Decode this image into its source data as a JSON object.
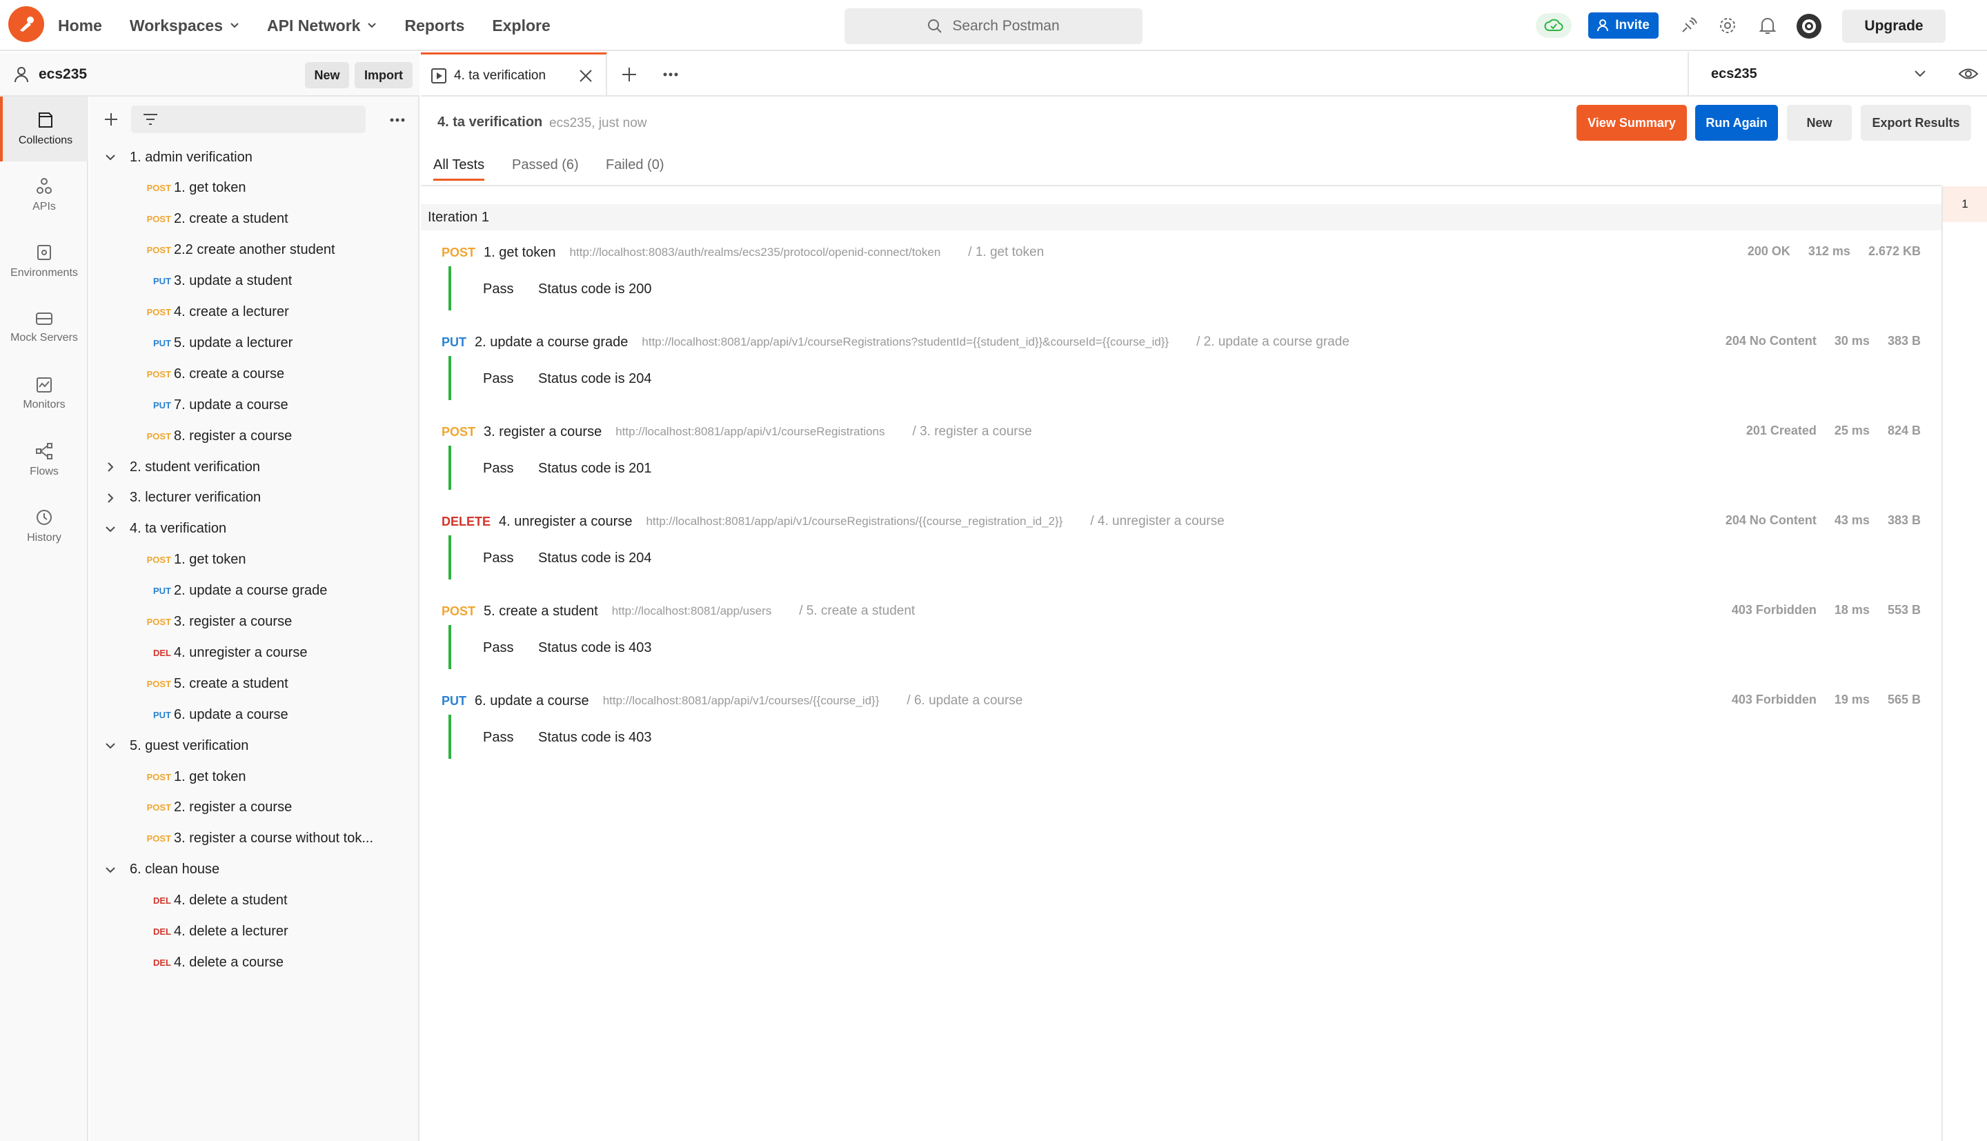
{
  "app": {
    "brand_color": "#ef5b25",
    "nav": [
      "Home",
      "Workspaces",
      "API Network",
      "Reports",
      "Explore"
    ],
    "search_placeholder": "Search Postman",
    "invite_label": "Invite",
    "upgrade_label": "Upgrade"
  },
  "workspace": {
    "name": "ecs235",
    "new_label": "New",
    "import_label": "Import"
  },
  "rail": [
    "Collections",
    "APIs",
    "Environments",
    "Mock Servers",
    "Monitors",
    "Flows",
    "History"
  ],
  "tree": [
    {
      "type": "folder",
      "label": "1. admin verification",
      "open": true
    },
    {
      "type": "req",
      "method": "POST",
      "label": "1. get token"
    },
    {
      "type": "req",
      "method": "POST",
      "label": "2. create a student"
    },
    {
      "type": "req",
      "method": "POST",
      "label": "2.2 create another student"
    },
    {
      "type": "req",
      "method": "PUT",
      "label": "3. update a student"
    },
    {
      "type": "req",
      "method": "POST",
      "label": "4. create a lecturer"
    },
    {
      "type": "req",
      "method": "PUT",
      "label": "5. update a lecturer"
    },
    {
      "type": "req",
      "method": "POST",
      "label": "6. create a course"
    },
    {
      "type": "req",
      "method": "PUT",
      "label": "7. update a course"
    },
    {
      "type": "req",
      "method": "POST",
      "label": "8. register a course"
    },
    {
      "type": "folder",
      "label": "2. student verification",
      "open": false
    },
    {
      "type": "folder",
      "label": "3. lecturer verification",
      "open": false
    },
    {
      "type": "folder",
      "label": "4. ta verification",
      "open": true
    },
    {
      "type": "req",
      "method": "POST",
      "label": "1. get token"
    },
    {
      "type": "req",
      "method": "PUT",
      "label": "2. update a course grade"
    },
    {
      "type": "req",
      "method": "POST",
      "label": "3. register a course"
    },
    {
      "type": "req",
      "method": "DEL",
      "label": "4. unregister a course"
    },
    {
      "type": "req",
      "method": "POST",
      "label": "5. create a student"
    },
    {
      "type": "req",
      "method": "PUT",
      "label": "6. update a course"
    },
    {
      "type": "folder",
      "label": "5. guest verification",
      "open": true
    },
    {
      "type": "req",
      "method": "POST",
      "label": "1. get token"
    },
    {
      "type": "req",
      "method": "POST",
      "label": "2. register a course"
    },
    {
      "type": "req",
      "method": "POST",
      "label": "3. register a course without tok..."
    },
    {
      "type": "folder",
      "label": "6. clean house",
      "open": true
    },
    {
      "type": "req",
      "method": "DEL",
      "label": "4. delete a student"
    },
    {
      "type": "req",
      "method": "DEL",
      "label": "4. delete a lecturer"
    },
    {
      "type": "req",
      "method": "DEL",
      "label": "4. delete a course"
    }
  ],
  "tab": {
    "title": "4. ta verification",
    "environment": "ecs235"
  },
  "runner": {
    "title": "4. ta verification",
    "subtitle": "ecs235, just now",
    "buttons": {
      "view_summary": "View Summary",
      "run_again": "Run Again",
      "new": "New",
      "export": "Export Results"
    },
    "filters": [
      "All Tests",
      "Passed (6)",
      "Failed (0)"
    ],
    "iteration_label": "Iteration 1",
    "iteration_number": "1",
    "requests": [
      {
        "method": "POST",
        "name": "1. get token",
        "url": "http://localhost:8083/auth/realms/ecs235/protocol/openid-connect/token",
        "path": "/ 1. get token",
        "status": "200 OK",
        "time": "312 ms",
        "size": "2.672 KB",
        "test_result": "Pass",
        "test_name": "Status code is 200"
      },
      {
        "method": "PUT",
        "name": "2. update a course grade",
        "url": "http://localhost:8081/app/api/v1/courseRegistrations?studentId={{student_id}}&courseId={{course_id}}",
        "path": "/ 2. update a course grade",
        "status": "204 No Content",
        "time": "30 ms",
        "size": "383 B",
        "test_result": "Pass",
        "test_name": "Status code is 204"
      },
      {
        "method": "POST",
        "name": "3. register a course",
        "url": "http://localhost:8081/app/api/v1/courseRegistrations",
        "path": "/ 3. register a course",
        "status": "201 Created",
        "time": "25 ms",
        "size": "824 B",
        "test_result": "Pass",
        "test_name": "Status code is 201"
      },
      {
        "method": "DELETE",
        "name": "4. unregister a course",
        "url": "http://localhost:8081/app/api/v1/courseRegistrations/{{course_registration_id_2}}",
        "path": "/ 4. unregister a course",
        "status": "204 No Content",
        "time": "43 ms",
        "size": "383 B",
        "test_result": "Pass",
        "test_name": "Status code is 204"
      },
      {
        "method": "POST",
        "name": "5. create a student",
        "url": "http://localhost:8081/app/users",
        "path": "/ 5. create a student",
        "status": "403 Forbidden",
        "time": "18 ms",
        "size": "553 B",
        "test_result": "Pass",
        "test_name": "Status code is 403"
      },
      {
        "method": "PUT",
        "name": "6. update a course",
        "url": "http://localhost:8081/app/api/v1/courses/{{course_id}}",
        "path": "/ 6. update a course",
        "status": "403 Forbidden",
        "time": "19 ms",
        "size": "565 B",
        "test_result": "Pass",
        "test_name": "Status code is 403"
      }
    ]
  }
}
